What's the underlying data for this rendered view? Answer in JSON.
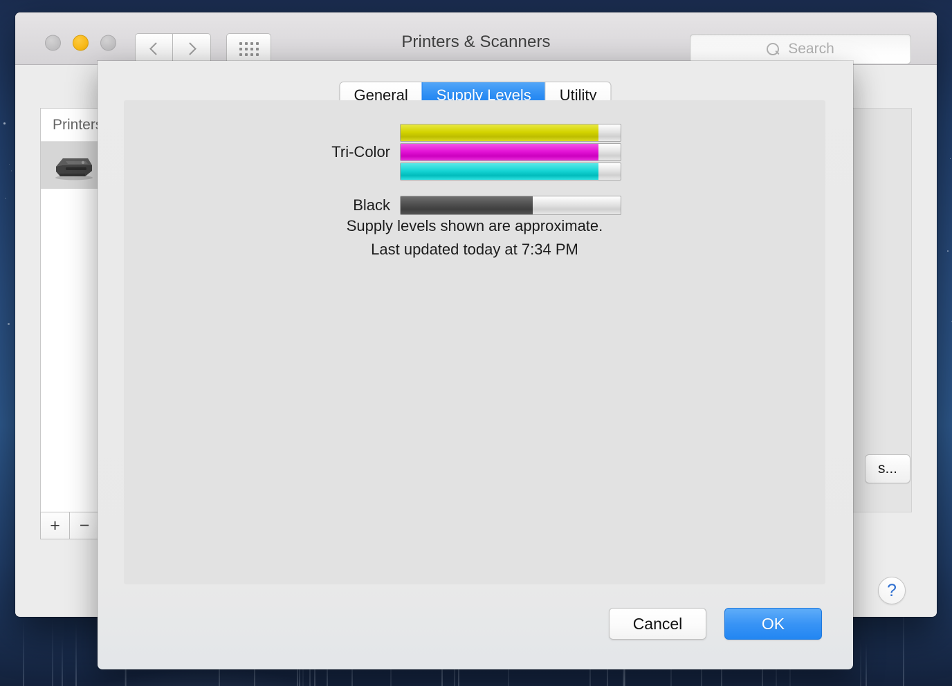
{
  "window": {
    "title": "Printers & Scanners",
    "traffic_lights": [
      "close",
      "minimize",
      "zoom"
    ],
    "nav": {
      "back_icon": "chevron-left-icon",
      "forward_icon": "chevron-right-icon",
      "grid_icon": "grid-view-icon"
    },
    "search": {
      "placeholder": "Search",
      "value": "",
      "icon": "search-icon"
    }
  },
  "sidebar": {
    "header": "Printers",
    "items": [
      {
        "name": "",
        "icon": "printer-icon",
        "selected": true
      }
    ],
    "add_label": "+",
    "remove_label": "−"
  },
  "detail": {
    "options_button": "s...",
    "help_button": "?"
  },
  "sheet": {
    "tabs": [
      {
        "label": "General",
        "active": false
      },
      {
        "label": "Supply Levels",
        "active": true
      },
      {
        "label": "Utility",
        "active": false
      }
    ],
    "supplies": [
      {
        "label": "Tri-Color",
        "gauges": [
          {
            "name": "yellow",
            "color": "#d3d300",
            "level": 90
          },
          {
            "name": "magenta",
            "color": "#e313d6",
            "level": 90
          },
          {
            "name": "cyan",
            "color": "#16d4d4",
            "level": 90
          }
        ]
      },
      {
        "label": "Black",
        "gauges": [
          {
            "name": "black",
            "color": "#4d4d4d",
            "level": 60
          }
        ]
      }
    ],
    "note_line_1": "Supply levels shown are approximate.",
    "note_line_2": "Last updated today at 7:34 PM",
    "cancel_label": "Cancel",
    "ok_label": "OK"
  },
  "colors": {
    "accent_blue": "#2286f2",
    "tab_active_blue": "#2b8cf3",
    "window_chrome": "#ececec",
    "sheet_panel": "#e2e2e2"
  }
}
